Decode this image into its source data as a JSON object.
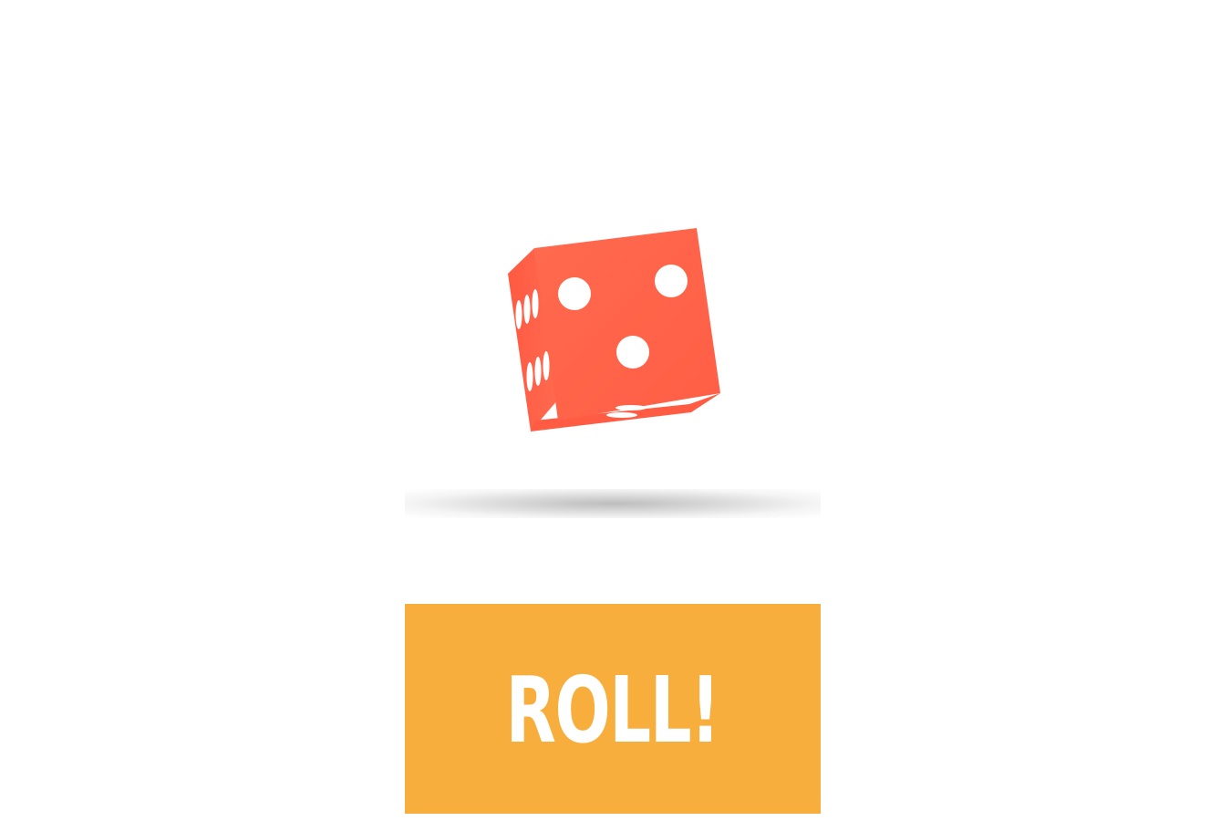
{
  "game": {
    "die": {
      "visible_face_value": 3,
      "color": "#ff6349",
      "pip_color": "#ffffff"
    },
    "roll_button": {
      "label": "ROLL!",
      "color": "#f8ae3c"
    }
  }
}
